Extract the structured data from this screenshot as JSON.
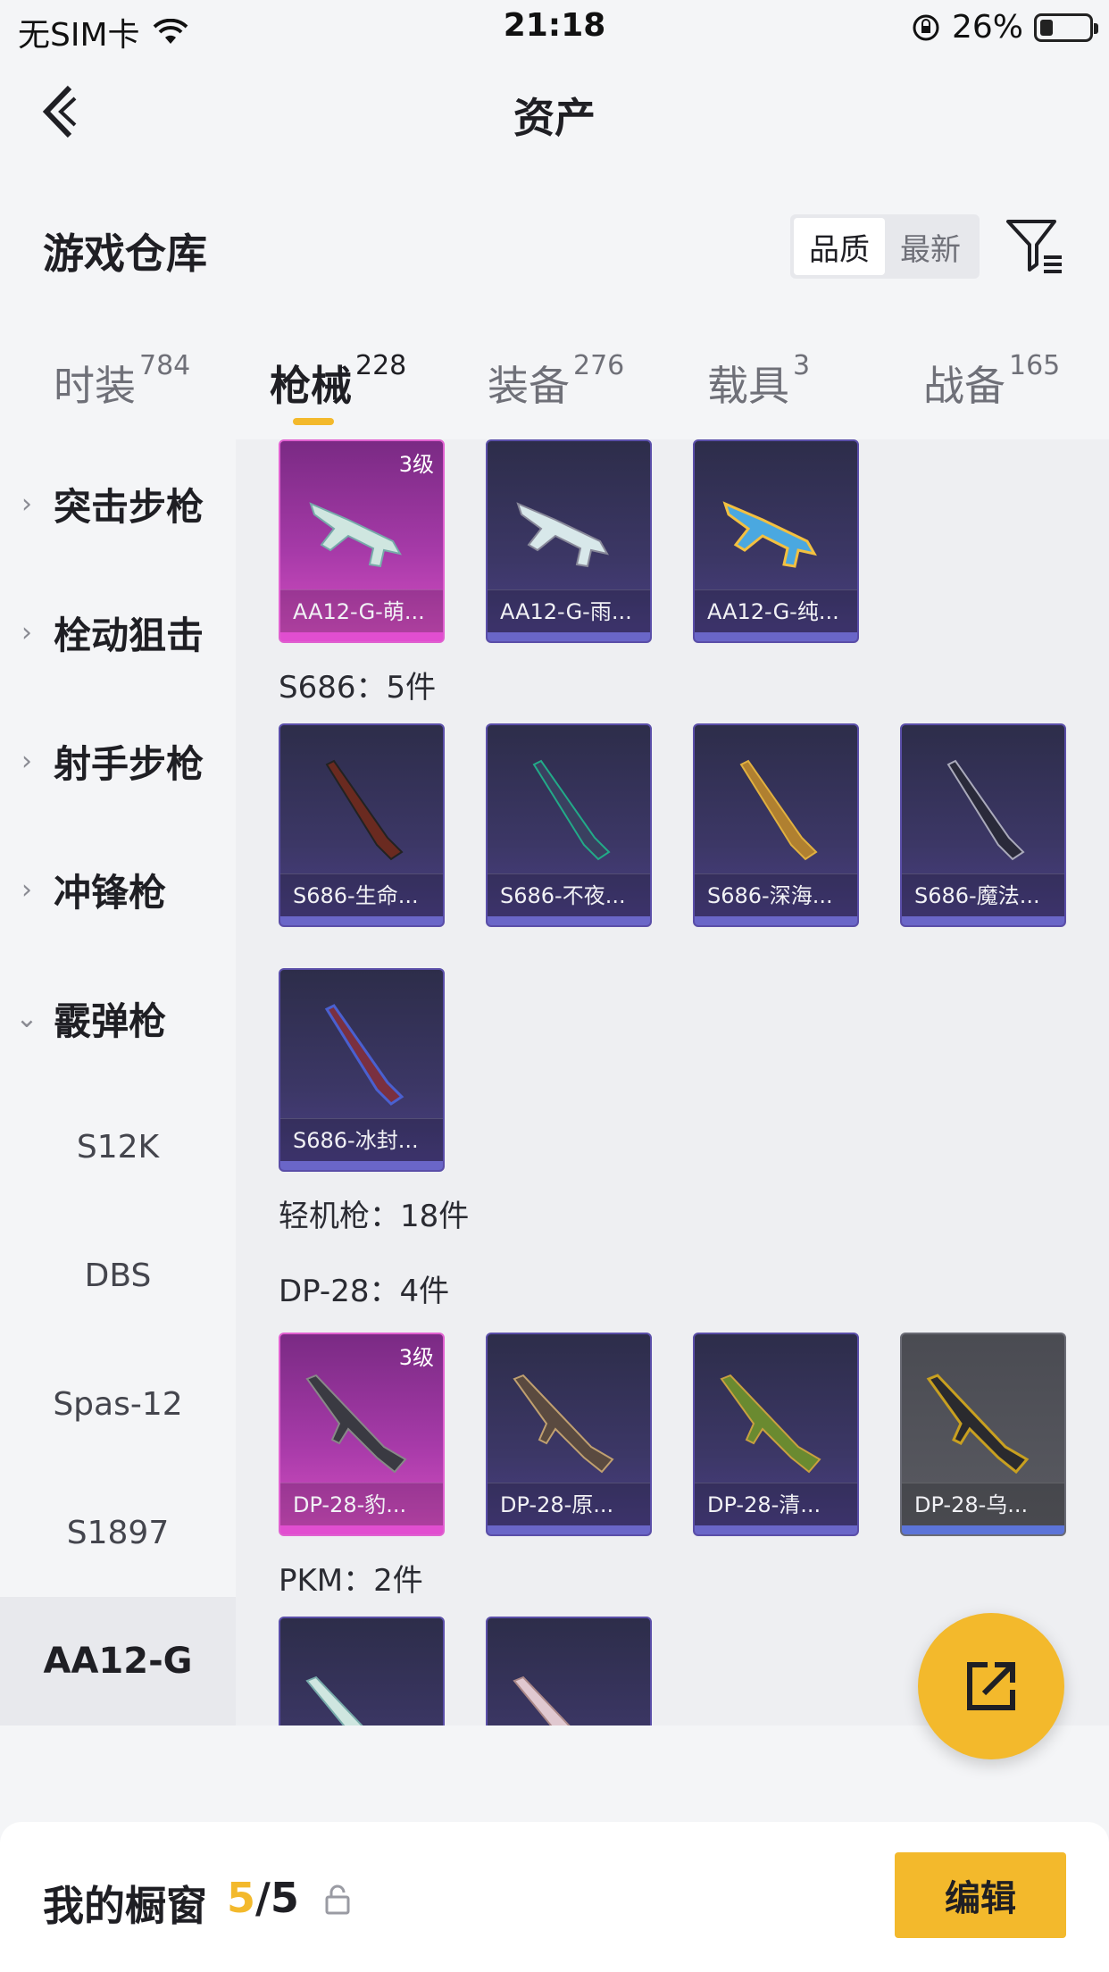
{
  "status_bar": {
    "carrier": "无SIM卡",
    "time": "21:18",
    "battery": "26%",
    "battery_level": 0.26
  },
  "header": {
    "title": "资产"
  },
  "section": {
    "title": "游戏仓库",
    "sort_options": [
      "品质",
      "最新"
    ],
    "active_sort": "品质"
  },
  "tabs": [
    {
      "label": "时装",
      "count": "784"
    },
    {
      "label": "枪械",
      "count": "228"
    },
    {
      "label": "装备",
      "count": "276"
    },
    {
      "label": "载具",
      "count": "3"
    },
    {
      "label": "战备",
      "count": "165"
    }
  ],
  "sidebar": {
    "categories": [
      "突击步枪",
      "栓动狙击",
      "射手步枪",
      "冲锋枪",
      "霰弹枪"
    ],
    "sub_items": [
      "S12K",
      "DBS",
      "Spas-12",
      "S1897",
      "AA12-G"
    ],
    "active_sub": "AA12-G"
  },
  "content": {
    "aa12_cards": [
      {
        "name": "AA12-G-萌...",
        "level": "3级",
        "style": "pink"
      },
      {
        "name": "AA12-G-雨...",
        "style": "purple"
      },
      {
        "name": "AA12-G-纯...",
        "style": "purple"
      }
    ],
    "s686_label": "S686：5件",
    "s686_cards": [
      {
        "name": "S686-生命...",
        "style": "purple"
      },
      {
        "name": "S686-不夜...",
        "style": "purple"
      },
      {
        "name": "S686-深海...",
        "style": "purple"
      },
      {
        "name": "S686-魔法...",
        "style": "purple"
      },
      {
        "name": "S686-冰封...",
        "style": "purple"
      }
    ],
    "lmg_label": "轻机枪：18件",
    "dp28_label": "DP-28：4件",
    "dp28_cards": [
      {
        "name": "DP-28-豹...",
        "level": "3级",
        "style": "pink"
      },
      {
        "name": "DP-28-原...",
        "style": "purple"
      },
      {
        "name": "DP-28-清...",
        "style": "purple"
      },
      {
        "name": "DP-28-乌...",
        "style": "gray"
      }
    ],
    "pkm_label": "PKM：2件"
  },
  "bottom_bar": {
    "label": "我的橱窗",
    "current": "5",
    "total": "/5",
    "edit_label": "编辑"
  },
  "colors": {
    "accent": "#f3b92c",
    "card_purple": "#3c3766",
    "card_pink": "#a63aa8",
    "card_gray": "#5a5b62"
  },
  "icons": [
    "back-arrow-icon",
    "filter-icon",
    "chevron-right-icon",
    "chevron-down-icon",
    "share-icon",
    "lock-icon",
    "wifi-icon",
    "rotation-lock-icon",
    "battery-icon"
  ]
}
